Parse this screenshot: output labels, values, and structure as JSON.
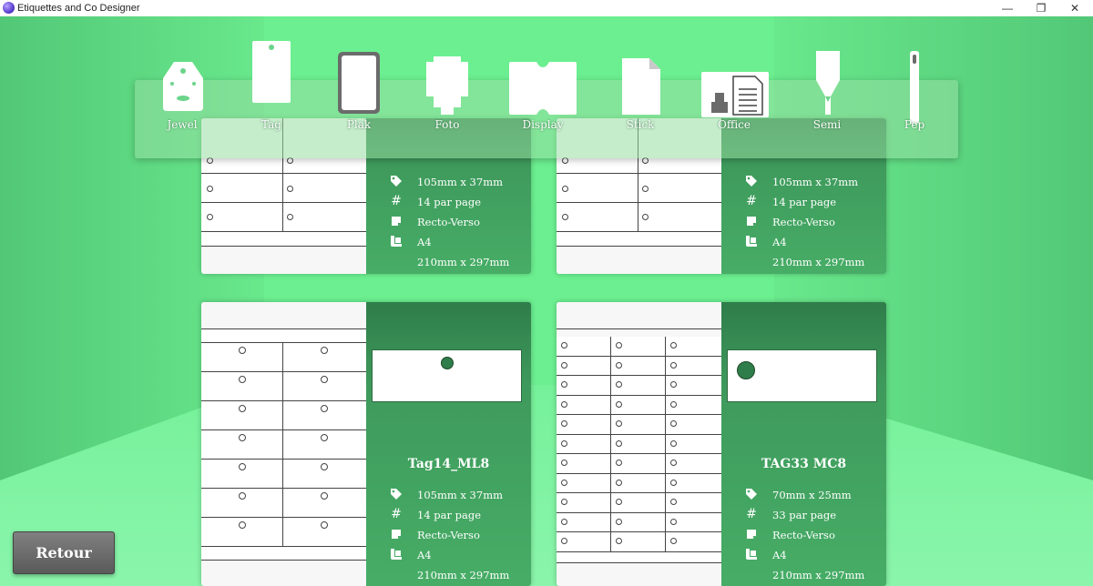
{
  "window": {
    "title": "Etiquettes and Co Designer",
    "min": "—",
    "max": "❐",
    "close": "✕"
  },
  "toolbar": {
    "items": [
      {
        "label": "Jewel"
      },
      {
        "label": "Tag"
      },
      {
        "label": "Plak"
      },
      {
        "label": "Foto"
      },
      {
        "label": "Display"
      },
      {
        "label": "Stick"
      },
      {
        "label": "Office"
      },
      {
        "label": "Semi"
      },
      {
        "label": "Pep"
      }
    ]
  },
  "cards": [
    {
      "name": "",
      "size": "105mm x 37mm",
      "per_page": "14 par page",
      "sides": "Recto-Verso",
      "paper": "A4",
      "paper_size": "210mm x 297mm"
    },
    {
      "name": "",
      "size": "105mm x 37mm",
      "per_page": "14 par page",
      "sides": "Recto-Verso",
      "paper": "A4",
      "paper_size": "210mm x 297mm"
    },
    {
      "name": "Tag14_ML8",
      "size": "105mm x 37mm",
      "per_page": "14 par page",
      "sides": "Recto-Verso",
      "paper": "A4",
      "paper_size": "210mm x 297mm"
    },
    {
      "name": "TAG33 MC8",
      "size": "70mm x 25mm",
      "per_page": "33 par page",
      "sides": "Recto-Verso",
      "paper": "A4",
      "paper_size": "210mm x 297mm"
    }
  ],
  "icons": {
    "size": "tag-icon",
    "count": "hash-icon",
    "sides": "page-flip-icon",
    "paper": "paper-sheet-icon"
  },
  "retour_label": "Retour",
  "colors": {
    "accent": "#3e9a5c",
    "background": "#6ee890"
  }
}
